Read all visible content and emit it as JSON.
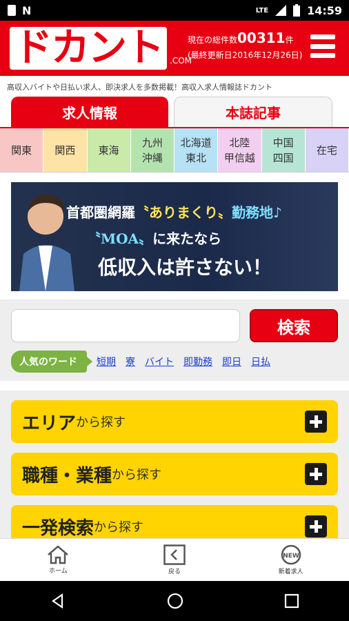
{
  "status": {
    "time": "14:59",
    "network": "LTE"
  },
  "header": {
    "logo": "ドカント",
    "logo_suffix": ".COM",
    "count_label": "現在の総件数",
    "count": "00311",
    "count_unit": "件",
    "updated": "(最終更新日2016年12月26日)"
  },
  "tagline": "高収入バイトや日払い求人、即決求人を多数掲載！高収入求人情報誌ドカント",
  "tabs": [
    {
      "label": "求人情報"
    },
    {
      "label": "本誌記事"
    }
  ],
  "regions": [
    {
      "label": "関東",
      "color": "#f9c6c6"
    },
    {
      "label": "関西",
      "color": "#fde3a6"
    },
    {
      "label": "東海",
      "color": "#c9eaa8"
    },
    {
      "label": "九州\n沖縄",
      "color": "#b5e3b0"
    },
    {
      "label": "北海道\n東北",
      "color": "#b7e1f5"
    },
    {
      "label": "北陸\n甲信越",
      "color": "#f2cff0"
    },
    {
      "label": "中国\n四国",
      "color": "#b6e5d6"
    },
    {
      "label": "在宅",
      "color": "#d9d2f7"
    }
  ],
  "banner": {
    "l1a": "首都圏網羅",
    "l1b": "〝ありまくり〟",
    "l1c": "勤務地♪",
    "l2a": "〝MOA〟",
    "l2b": "に来たなら",
    "l3": "低収入は許さない！"
  },
  "search": {
    "placeholder": "",
    "button": "検索"
  },
  "popular": {
    "label": "人気のワード",
    "words": [
      "短期",
      "寮",
      "バイト",
      "即勤務",
      "即日",
      "日払"
    ]
  },
  "categories": [
    {
      "main": "エリア",
      "sub": "から探す"
    },
    {
      "main": "職種・業種",
      "sub": "から探す"
    },
    {
      "main": "一発検索",
      "sub": "から探す"
    }
  ],
  "bottom_nav": [
    {
      "label": "ホーム",
      "icon": "home-icon"
    },
    {
      "label": "戻る",
      "icon": "back-icon"
    },
    {
      "label": "新着求人",
      "icon": "new-icon"
    }
  ]
}
